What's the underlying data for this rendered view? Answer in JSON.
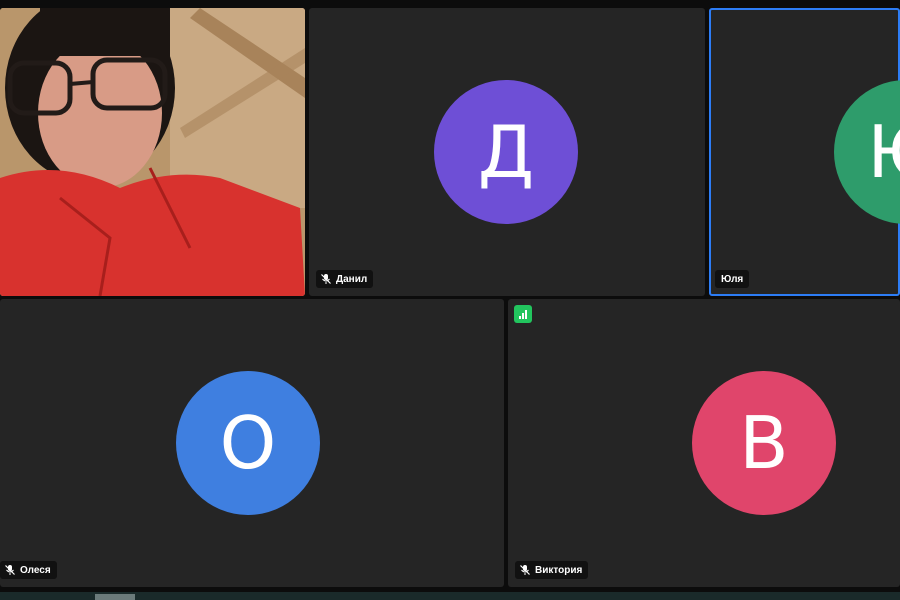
{
  "participants": [
    {
      "name": "Данил",
      "initial": "Д",
      "color": "#6e4fd6",
      "muted": true
    },
    {
      "name": "Юля",
      "initial": "Ю",
      "color": "#2e9c6b",
      "muted": false,
      "speaking": true
    },
    {
      "name": "Олеся",
      "initial": "О",
      "color": "#3f7fe0",
      "muted": true
    },
    {
      "name": "Виктория",
      "initial": "В",
      "color": "#e0456b",
      "muted": true
    }
  ],
  "self_view": {
    "description_icon": "video-feed"
  },
  "icons": {
    "mute": "mic-off-icon",
    "signal": "network-signal-icon"
  }
}
